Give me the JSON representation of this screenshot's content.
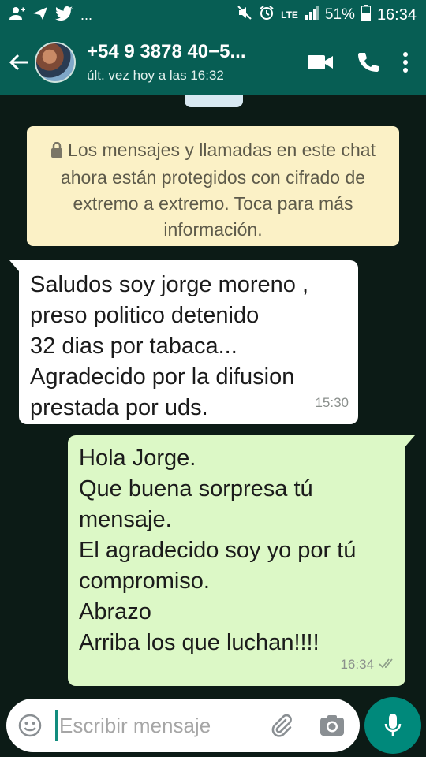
{
  "status_bar": {
    "left_icons": [
      "person-add-icon",
      "send-icon",
      "twitter-icon"
    ],
    "ellipsis": "...",
    "network": "LTE",
    "battery_pct": "51%",
    "time": "16:34"
  },
  "header": {
    "contact": "+54 9 3878 40−5...",
    "last_seen": "últ. vez hoy a las 16:32"
  },
  "notice": {
    "text": "Los mensajes y llamadas en este chat ahora están protegidos con cifrado de extremo a extremo. Toca para más información."
  },
  "messages": [
    {
      "direction": "incoming",
      "text": "Saludos soy jorge moreno ,\npreso politico detenido\n32 dias por tabaca...\nAgradecido por la difusion\nprestada por uds.",
      "time": "15:30"
    },
    {
      "direction": "outgoing",
      "text": "Hola Jorge.\nQue buena sorpresa tú\nmensaje.\nEl agradecido soy yo por tú\ncompromiso.\nAbrazo\nArriba los que luchan!!!!",
      "time": "16:34",
      "status": "read"
    }
  ],
  "composer": {
    "placeholder": "Escribir mensaje"
  },
  "colors": {
    "brand": "#075e54",
    "outgoing_bubble": "#dcf8c6",
    "notice_bg": "#fbf1c6",
    "mic_button": "#00897b"
  }
}
